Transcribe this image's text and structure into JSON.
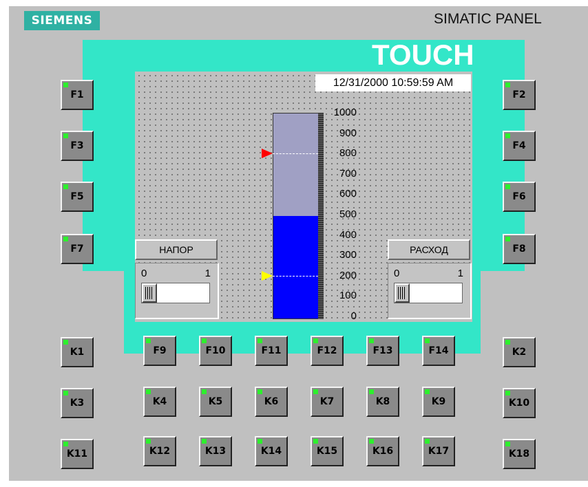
{
  "brand": {
    "logo": "SIEMENS",
    "model": "SIMATIC PANEL",
    "series": "TOUCH"
  },
  "screen": {
    "datetime": "12/31/2000 10:59:59 AM",
    "bar_gauge": {
      "value": 500,
      "max": 1000,
      "fill_color": "#0000ff",
      "empty_color": "#a0a0c4",
      "scale": [
        "1000",
        "900",
        "800",
        "700",
        "600",
        "500",
        "400",
        "300",
        "200",
        "100",
        "0"
      ],
      "upper_marker": {
        "value": 800,
        "color": "#ff0000"
      },
      "lower_marker": {
        "value": 200,
        "color": "#ffff00"
      }
    },
    "controls": [
      {
        "label": "НАПОР",
        "min": "0",
        "max": "1",
        "value": 0
      },
      {
        "label": "РАСХОД",
        "min": "0",
        "max": "1",
        "value": 0
      }
    ]
  },
  "keys": {
    "F1": "F1",
    "F2": "F2",
    "F3": "F3",
    "F4": "F4",
    "F5": "F5",
    "F6": "F6",
    "F7": "F7",
    "F8": "F8",
    "F9": "F9",
    "F10": "F10",
    "F11": "F11",
    "F12": "F12",
    "F13": "F13",
    "F14": "F14",
    "K1": "K1",
    "K2": "K2",
    "K3": "K3",
    "K4": "K4",
    "K5": "K5",
    "K6": "K6",
    "K7": "K7",
    "K8": "K8",
    "K9": "K9",
    "K10": "K10",
    "K11": "K11",
    "K12": "K12",
    "K13": "K13",
    "K14": "K14",
    "K15": "K15",
    "K16": "K16",
    "K17": "K17",
    "K18": "K18"
  },
  "colors": {
    "bezel": "#33e6c8",
    "logo_bg": "#2fb1a3",
    "led": "#2df02d"
  }
}
